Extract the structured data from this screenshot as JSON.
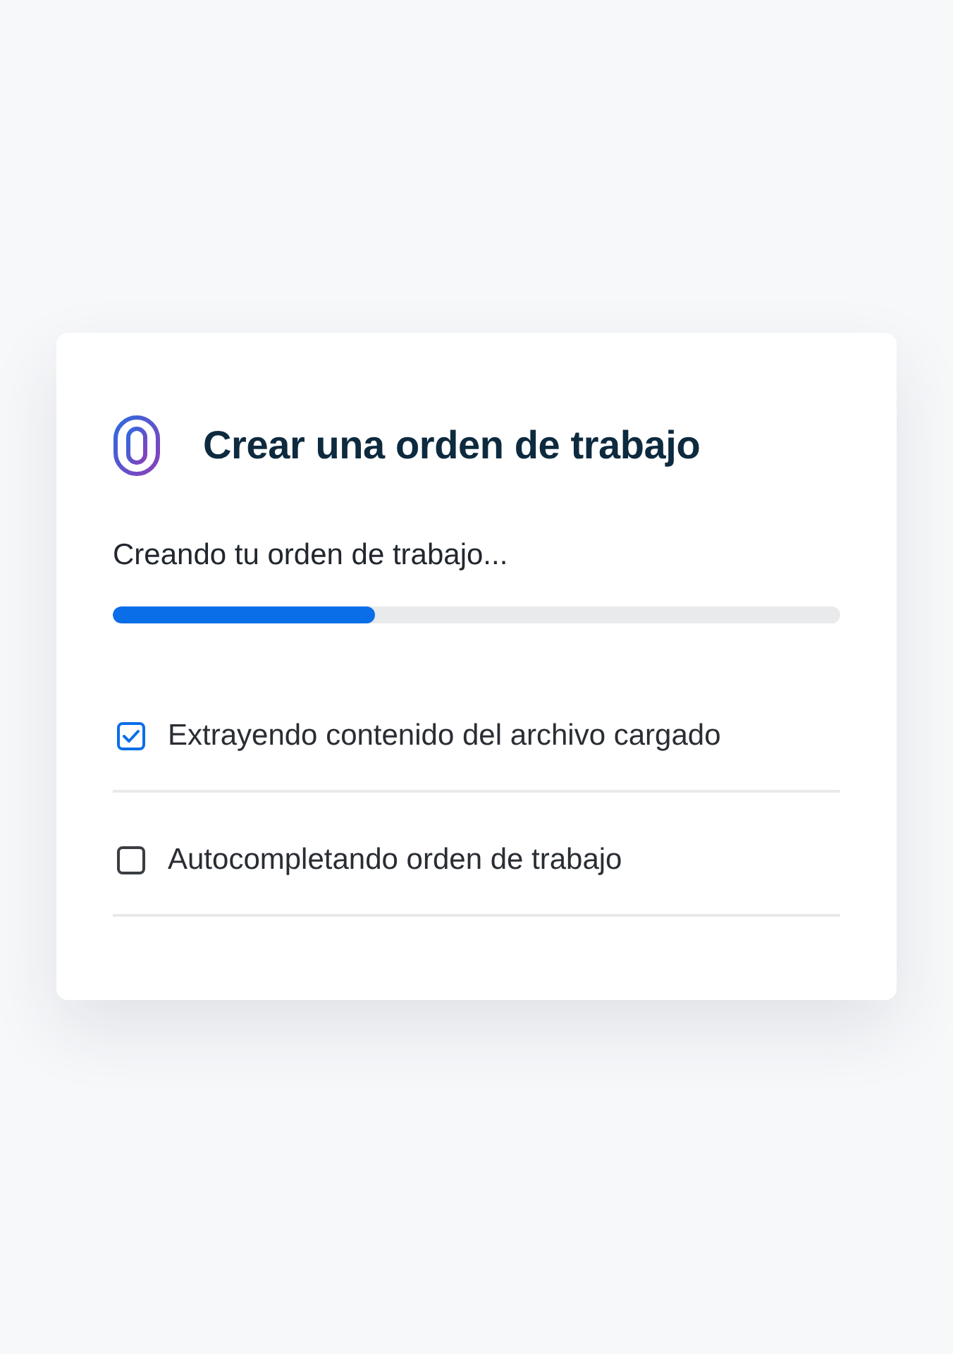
{
  "dialog": {
    "title": "Crear una orden de trabajo",
    "status": "Creando tu orden de trabajo...",
    "progress": {
      "level": 0.36
    },
    "steps": [
      {
        "label": "Extrayendo contenido del archivo cargado",
        "checked": true
      },
      {
        "label": "Autocompletando orden de trabajo",
        "checked": false
      }
    ]
  }
}
